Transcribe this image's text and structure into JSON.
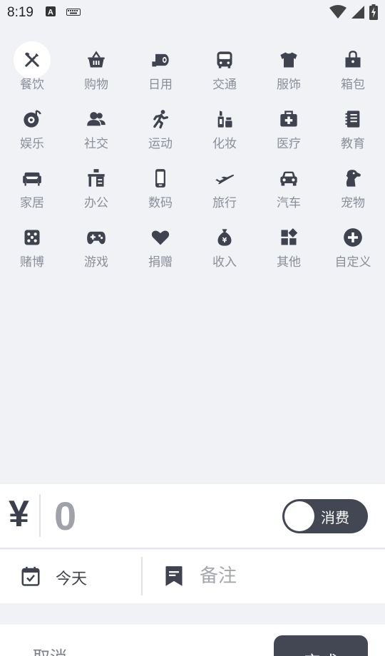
{
  "status_bar": {
    "time": "8:19",
    "left_icons": [
      "a-badge-icon",
      "keyboard-icon"
    ],
    "right_icons": [
      "wifi-icon",
      "signal-icon",
      "battery-charging-icon"
    ]
  },
  "categories": [
    {
      "label": "餐饮",
      "icon": "fork-knife-icon",
      "selected": true
    },
    {
      "label": "购物",
      "icon": "basket-icon"
    },
    {
      "label": "日用",
      "icon": "toilet-paper-icon"
    },
    {
      "label": "交通",
      "icon": "bus-icon"
    },
    {
      "label": "服饰",
      "icon": "tshirt-icon"
    },
    {
      "label": "箱包",
      "icon": "bag-icon"
    },
    {
      "label": "娱乐",
      "icon": "music-disc-icon"
    },
    {
      "label": "社交",
      "icon": "people-icon"
    },
    {
      "label": "运动",
      "icon": "running-icon"
    },
    {
      "label": "化妆",
      "icon": "cosmetics-icon"
    },
    {
      "label": "医疗",
      "icon": "medical-kit-icon"
    },
    {
      "label": "教育",
      "icon": "notebook-icon"
    },
    {
      "label": "家居",
      "icon": "sofa-icon"
    },
    {
      "label": "办公",
      "icon": "office-desk-icon"
    },
    {
      "label": "数码",
      "icon": "phone-icon"
    },
    {
      "label": "旅行",
      "icon": "airplane-icon"
    },
    {
      "label": "汽车",
      "icon": "car-icon"
    },
    {
      "label": "宠物",
      "icon": "dog-icon"
    },
    {
      "label": "赌博",
      "icon": "dice-icon"
    },
    {
      "label": "游戏",
      "icon": "gamepad-icon"
    },
    {
      "label": "捐赠",
      "icon": "heart-icon"
    },
    {
      "label": "收入",
      "icon": "money-bag-icon"
    },
    {
      "label": "其他",
      "icon": "widgets-icon"
    },
    {
      "label": "自定义",
      "icon": "plus-circle-icon"
    }
  ],
  "amount": {
    "currency_symbol": "¥",
    "value": "0",
    "type_toggle_label": "消费"
  },
  "date_button": {
    "label": "今天"
  },
  "note": {
    "placeholder": "备注",
    "value": ""
  },
  "actions": {
    "cancel_label": "取消",
    "done_label": "完成"
  },
  "colors": {
    "background": "#f1f2f6",
    "accent": "#434653",
    "icon": "#3f4350",
    "label": "#8a8e99"
  }
}
